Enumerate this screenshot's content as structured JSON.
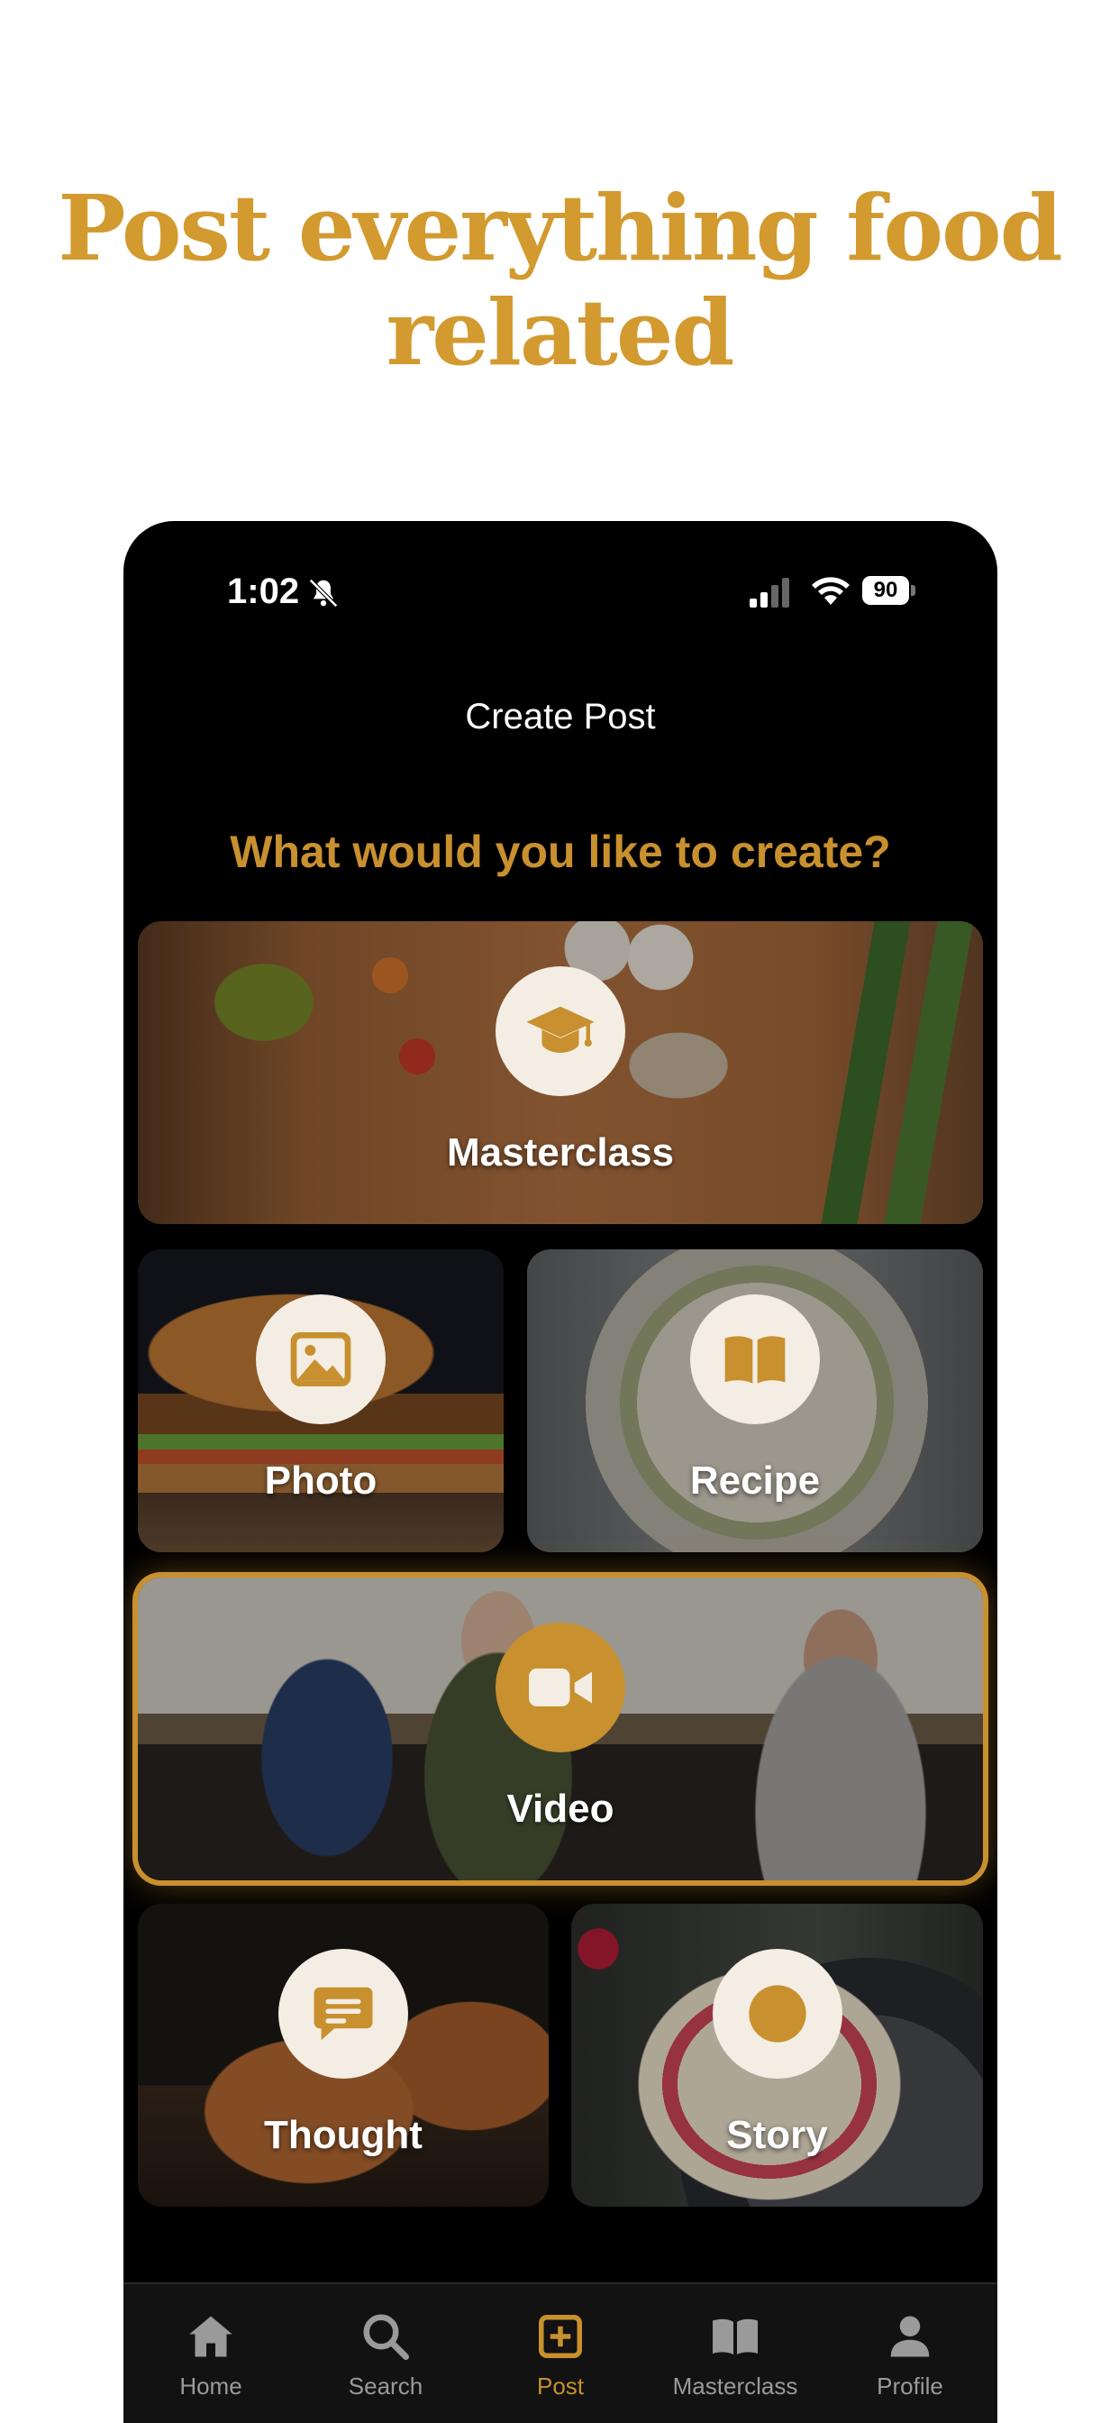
{
  "headline": "Post everything food related",
  "status_bar": {
    "time": "1:02",
    "battery": "90"
  },
  "screen": {
    "title": "Create Post",
    "question": "What would you like to create?"
  },
  "options": [
    {
      "label": "Masterclass",
      "icon": "graduation-cap-icon",
      "selected": false
    },
    {
      "label": "Photo",
      "icon": "image-icon",
      "selected": false
    },
    {
      "label": "Recipe",
      "icon": "open-book-icon",
      "selected": false
    },
    {
      "label": "Video",
      "icon": "video-camera-icon",
      "selected": true
    },
    {
      "label": "Thought",
      "icon": "chat-bubble-icon",
      "selected": false
    },
    {
      "label": "Story",
      "icon": "record-circle-icon",
      "selected": false
    }
  ],
  "tab_bar": {
    "items": [
      {
        "label": "Home",
        "icon": "home-icon"
      },
      {
        "label": "Search",
        "icon": "search-icon"
      },
      {
        "label": "Post",
        "icon": "plus-square-icon",
        "active": true
      },
      {
        "label": "Masterclass",
        "icon": "book-icon"
      },
      {
        "label": "Profile",
        "icon": "person-icon"
      }
    ]
  },
  "colors": {
    "accent": "#c8902e",
    "headline": "#d29a2f",
    "background": "#000000",
    "icon_circle": "#f3ede4"
  }
}
